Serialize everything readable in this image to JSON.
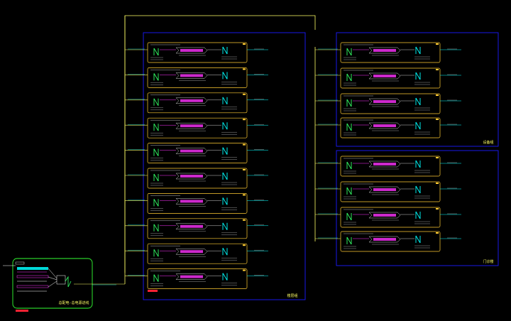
{
  "colors": {
    "background": "#000000",
    "bus_line": "#ffff66",
    "module_border": "#ffcc33",
    "group_border": "#1a1aff",
    "source_border": "#33ff33",
    "cyan": "#00ffff",
    "magenta": "#ff33ff",
    "green": "#33ff66",
    "red_tag": "#ff2233"
  },
  "source_block": {
    "label": "总配电-总电源进线"
  },
  "groups": [
    {
      "label": "楼层组"
    },
    {
      "label": "设备组"
    },
    {
      "label": "门诊楼"
    }
  ]
}
